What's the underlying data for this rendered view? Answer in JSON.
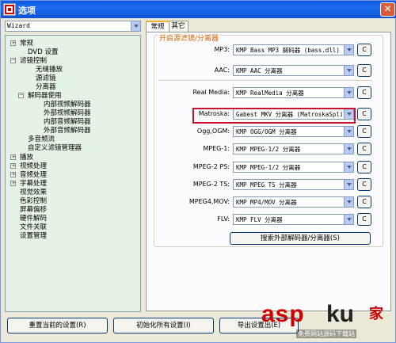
{
  "window": {
    "title": "选项",
    "close_glyph": "✕"
  },
  "profile": {
    "value": "Wizard"
  },
  "tree": {
    "items": [
      {
        "label": "常规",
        "exp": "+"
      },
      {
        "label": "DVD 设置",
        "exp": ""
      },
      {
        "label": "滤镜控制",
        "exp": "−"
      },
      {
        "label": "无缝播放",
        "exp": ""
      },
      {
        "label": "源滤镜",
        "exp": ""
      },
      {
        "label": "分离器",
        "exp": ""
      },
      {
        "label": "解码器使用",
        "exp": "−"
      },
      {
        "label": "内部视频解码器",
        "exp": ""
      },
      {
        "label": "外部视频解码器",
        "exp": ""
      },
      {
        "label": "内部音频解码器",
        "exp": ""
      },
      {
        "label": "外部音频解码器",
        "exp": ""
      },
      {
        "label": "多音频流",
        "exp": ""
      },
      {
        "label": "自定义滤镜管理器",
        "exp": ""
      },
      {
        "label": "播放",
        "exp": "+"
      },
      {
        "label": "视频处理",
        "exp": "+"
      },
      {
        "label": "音频处理",
        "exp": "+"
      },
      {
        "label": "字幕处理",
        "exp": "+"
      },
      {
        "label": "视觉效果",
        "exp": ""
      },
      {
        "label": "色彩控制",
        "exp": ""
      },
      {
        "label": "屏幕偏移",
        "exp": ""
      },
      {
        "label": "硬件解码",
        "exp": ""
      },
      {
        "label": "文件关联",
        "exp": ""
      },
      {
        "label": "设置管理",
        "exp": ""
      }
    ]
  },
  "tabs": [
    {
      "label": "常规"
    },
    {
      "label": "其它"
    }
  ],
  "group": {
    "title": "开启源滤镜/分离器"
  },
  "rows": [
    {
      "label": "MP3:",
      "value": "KMP Bass MP3 解码器 (bass.dll)",
      "button": "C"
    },
    {
      "label": "AAC:",
      "value": "KMP AAC 分离器",
      "button": "C"
    },
    {
      "label": "Real Media:",
      "value": "KMP RealMedia 分离器",
      "button": "C"
    },
    {
      "label": "Matroska:",
      "value": "Gabest MKV 分离器 (MatroskaSplitter)",
      "button": "C"
    },
    {
      "label": "Ogg,OGM:",
      "value": "KMP OGG/OGM 分离器",
      "button": "C"
    },
    {
      "label": "MPEG-1:",
      "value": "KMP MPEG-1/2 分离器",
      "button": "C"
    },
    {
      "label": "MPEG-2 PS:",
      "value": "KMP MPEG-1/2 分离器",
      "button": "C"
    },
    {
      "label": "MPEG-2 TS:",
      "value": "KMP MPEG TS 分离器",
      "button": "C"
    },
    {
      "label": "MPEG4,MOV:",
      "value": "KMP MP4/MOV 分离器",
      "button": "C"
    },
    {
      "label": "FLV:",
      "value": "KMP FLV 分离器",
      "button": "C"
    }
  ],
  "search_button": "搜索外部解码器/分离器(S)",
  "bottom_buttons": [
    {
      "label": "重置当前的设置(R)"
    },
    {
      "label": "初始化所有设置(I)"
    },
    {
      "label": "导出设置出(E)"
    }
  ],
  "watermark": {
    "asp": "asp",
    "ku": "ku",
    "jia": "家",
    "sub": "免费网站源码下载站"
  },
  "colors": {
    "group_title": "#d36300",
    "highlight": "#c8102e",
    "tree_bg": "#e5f3e5"
  }
}
